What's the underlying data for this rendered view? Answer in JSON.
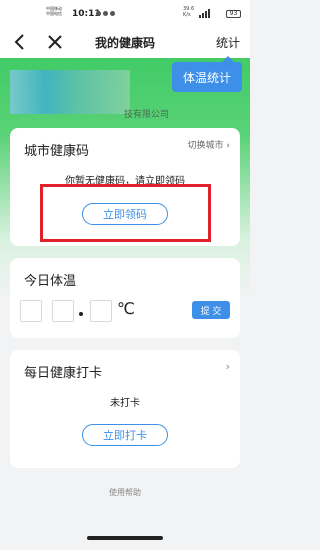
{
  "status_bar": {
    "carrier_1": "中国移动",
    "carrier_2": "中国电信",
    "time": "10:11",
    "net_speed": "39.6",
    "net_unit": "K/s",
    "battery": "93"
  },
  "nav": {
    "title": "我的健康码",
    "stats_link": "统计"
  },
  "temp_stats_button": "体温统计",
  "company_suffix": "技有限公司",
  "city_code_card": {
    "title": "城市健康码",
    "switch_city": "切换城市",
    "notice": "你暂无健康码，请立即领码",
    "claim_button": "立即领码"
  },
  "today_temp_card": {
    "title": "今日体温",
    "unit": "℃",
    "submit_button": "提 交"
  },
  "daily_checkin_card": {
    "title": "每日健康打卡",
    "status": "未打卡",
    "checkin_button": "立即打卡"
  },
  "help_link": "使用帮助",
  "colors": {
    "accent": "#3d8fe8",
    "highlight": "#e0202a",
    "header_green": "#2fc65a"
  }
}
